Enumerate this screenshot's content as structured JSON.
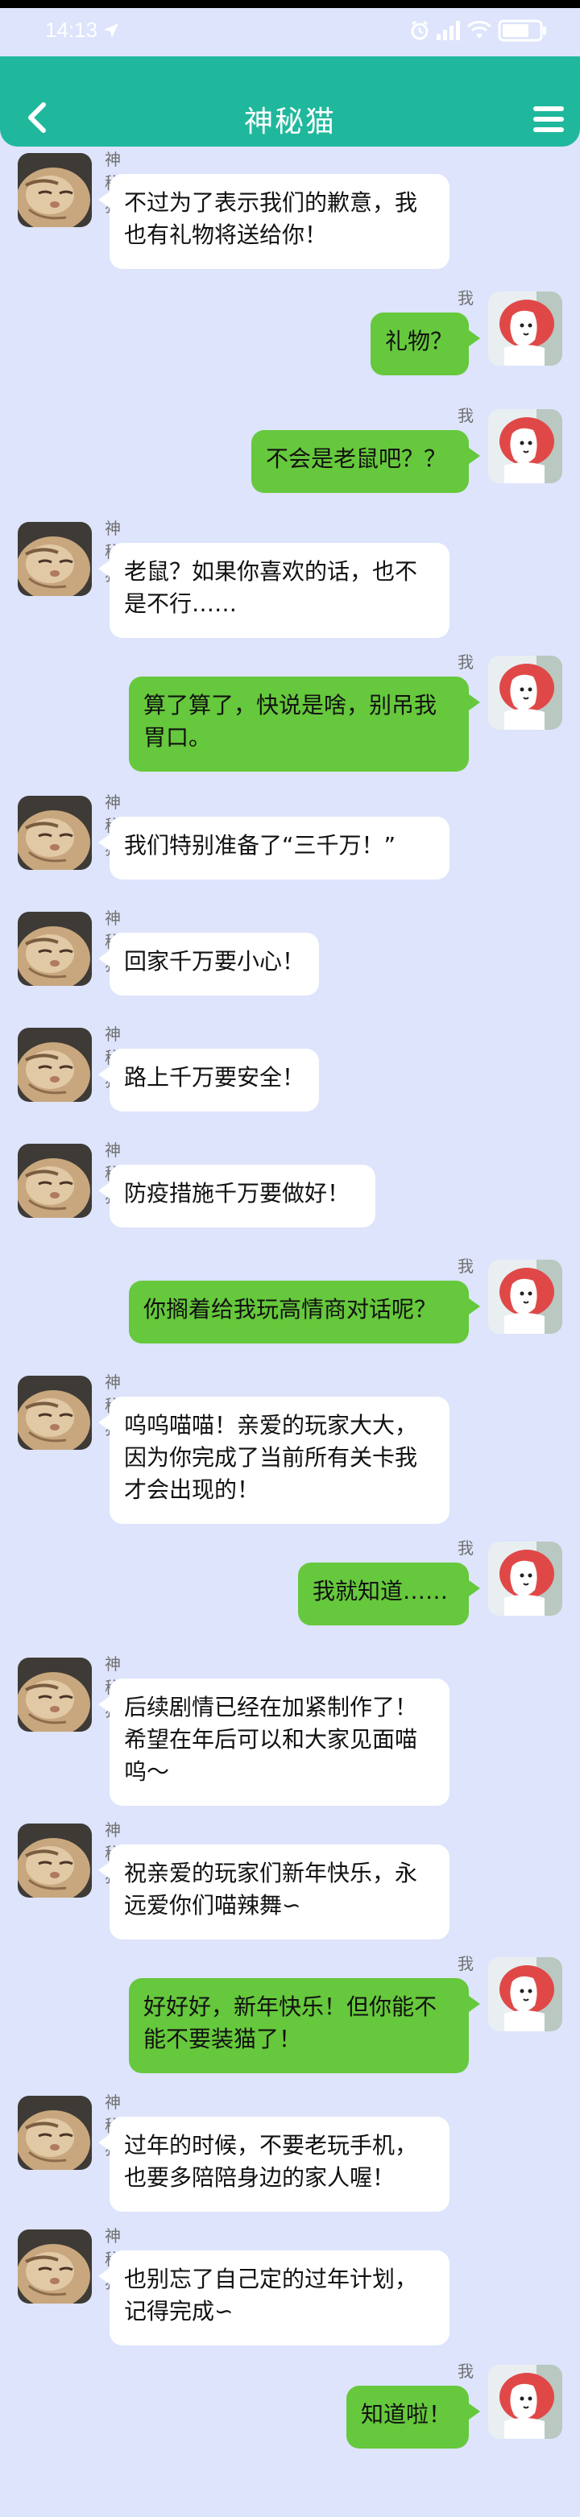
{
  "status_bar": {
    "time": "14:13"
  },
  "header": {
    "title": "神秘猫"
  },
  "labels": {
    "cat": "神秘猫",
    "me": "我"
  },
  "messages": [
    {
      "from": "cat",
      "text": "不过为了表示我们的歉意，我也有礼物将送给你！"
    },
    {
      "from": "me",
      "text": "礼物？"
    },
    {
      "from": "me",
      "text": "不会是老鼠吧？？"
    },
    {
      "from": "cat",
      "text": "老鼠？如果你喜欢的话，也不是不行……"
    },
    {
      "from": "me",
      "text": "算了算了，快说是啥，别吊我胃口。"
    },
    {
      "from": "cat",
      "text": "我们特别准备了“三千万！”"
    },
    {
      "from": "cat",
      "text": "回家千万要小心！"
    },
    {
      "from": "cat",
      "text": "路上千万要安全！"
    },
    {
      "from": "cat",
      "text": "防疫措施千万要做好！"
    },
    {
      "from": "me",
      "text": "你搁着给我玩高情商对话呢？"
    },
    {
      "from": "cat",
      "text": "呜呜喵喵！亲爱的玩家大大，因为你完成了当前所有关卡我才会出现的！"
    },
    {
      "from": "me",
      "text": "我就知道……"
    },
    {
      "from": "cat",
      "text": "后续剧情已经在加紧制作了！希望在年后可以和大家见面喵呜～"
    },
    {
      "from": "cat",
      "text": "祝亲爱的玩家们新年快乐，永远爱你们喵辣舞∽"
    },
    {
      "from": "me",
      "text": "好好好，新年快乐！但你能不能不要装猫了！"
    },
    {
      "from": "cat",
      "text": "过年的时候，不要老玩手机，也要多陪陪身边的家人喔！"
    },
    {
      "from": "cat",
      "text": "也别忘了自己定的过年计划，记得完成∽"
    },
    {
      "from": "me",
      "text": "知道啦！"
    }
  ]
}
